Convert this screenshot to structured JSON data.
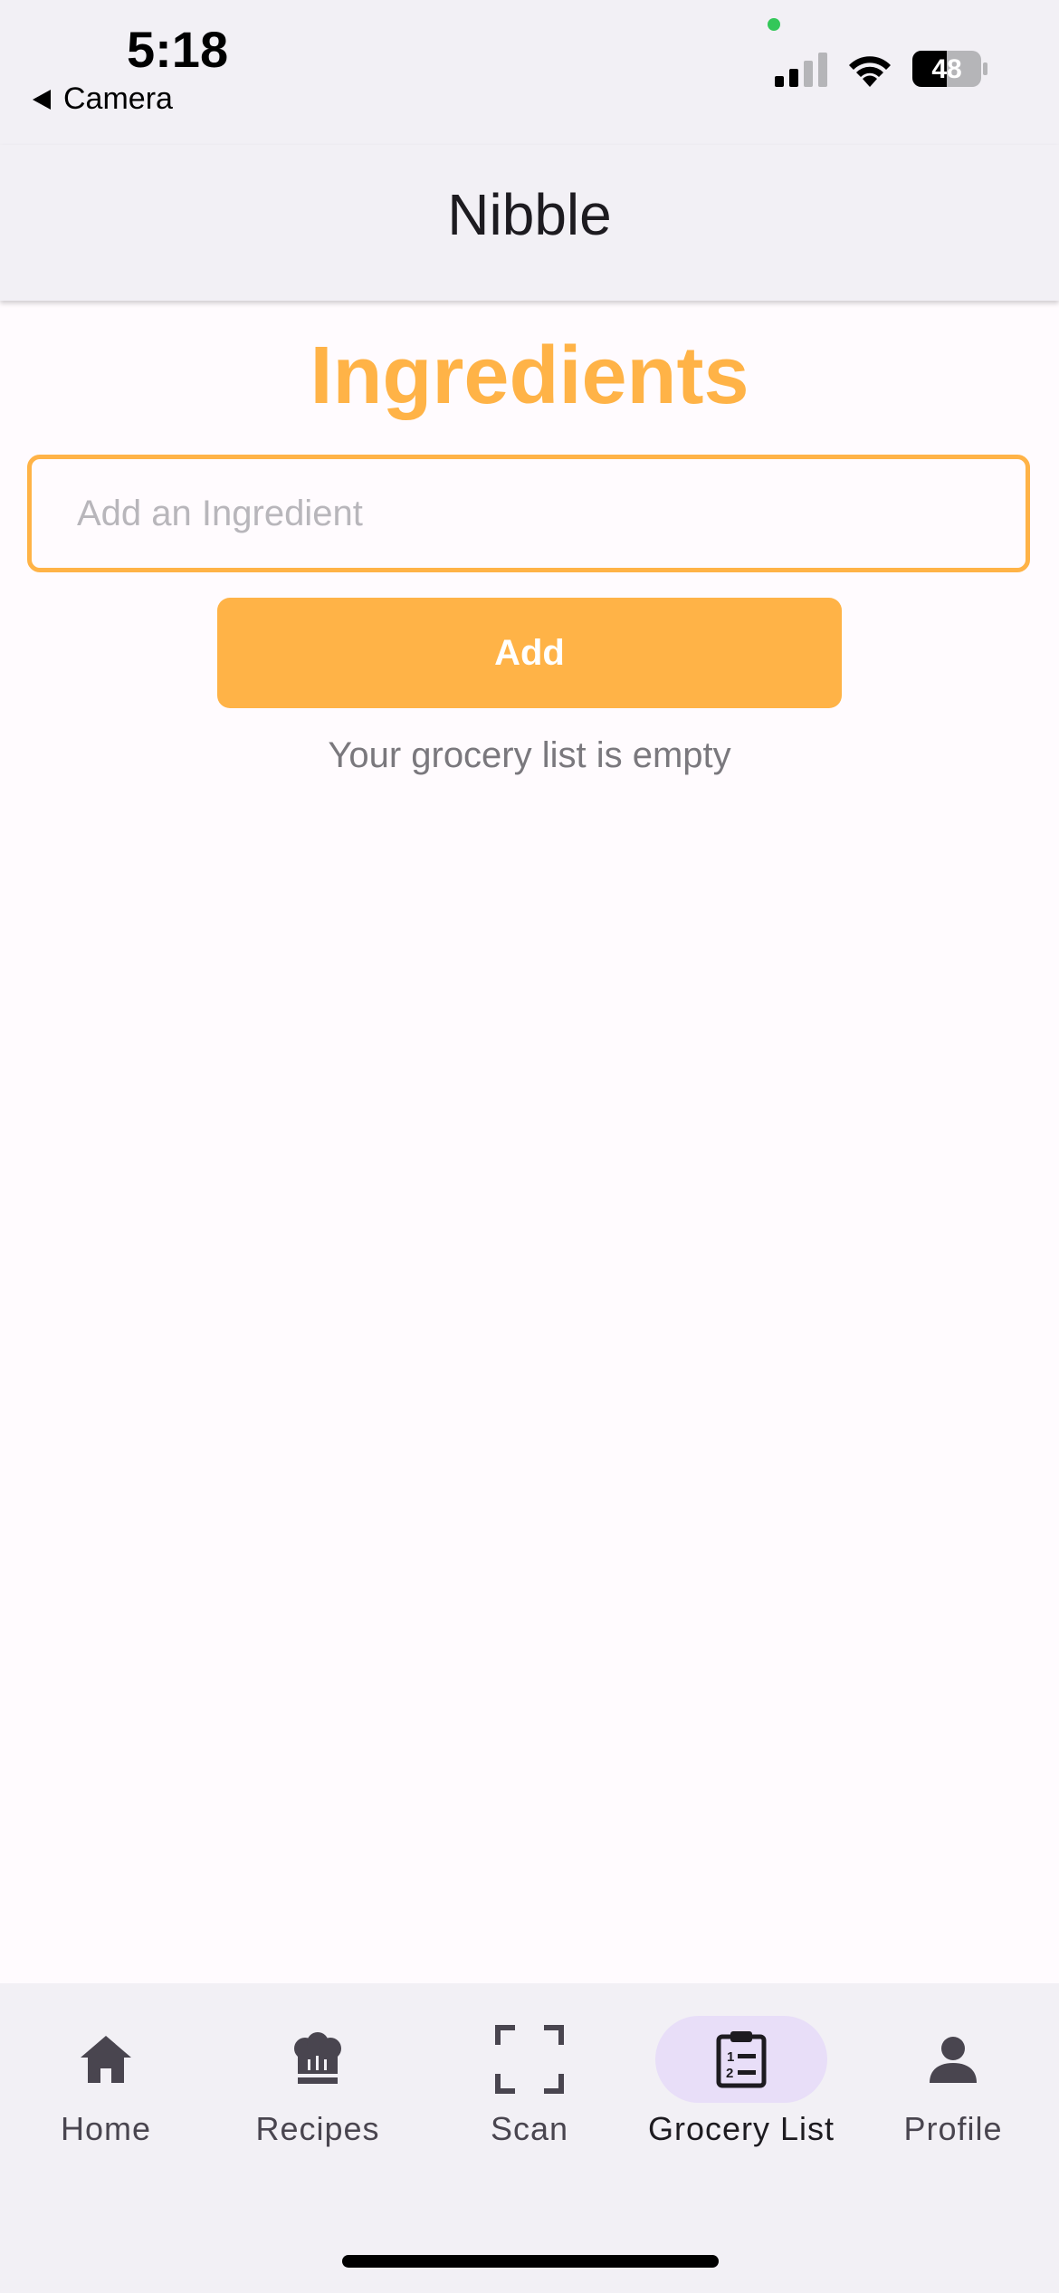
{
  "status_bar": {
    "time": "5:18",
    "back_label": "Camera",
    "battery_level": "48"
  },
  "app_bar": {
    "title": "Nibble"
  },
  "main": {
    "heading": "Ingredients",
    "input_placeholder": "Add an Ingredient",
    "input_value": "",
    "add_label": "Add",
    "empty_message": "Your grocery list is empty"
  },
  "bottom_nav": {
    "items": [
      {
        "label": "Home",
        "icon": "home-icon"
      },
      {
        "label": "Recipes",
        "icon": "chef-hat-icon"
      },
      {
        "label": "Scan",
        "icon": "scan-frame-icon"
      },
      {
        "label": "Grocery List",
        "icon": "clipboard-list-icon",
        "active": true
      },
      {
        "label": "Profile",
        "icon": "person-icon"
      }
    ]
  },
  "colors": {
    "accent": "#ffb347",
    "nav_active_pill": "#e8def8",
    "bar_background": "#f2f0f5"
  }
}
